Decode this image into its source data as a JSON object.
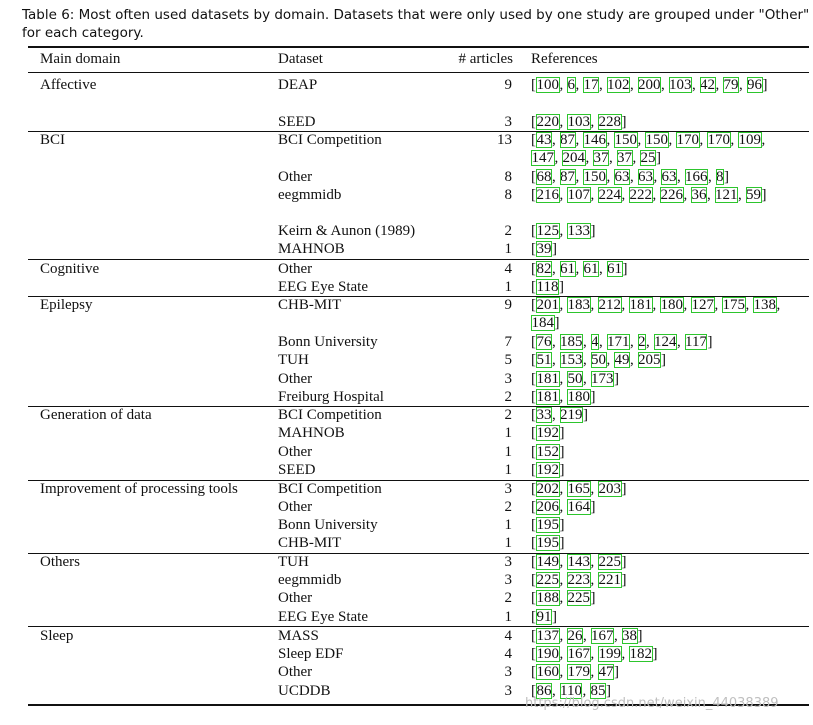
{
  "caption": "Table 6: Most often used datasets by domain. Datasets that were only used by one study are grouped under \"Other\" for each category.",
  "headers": [
    "Main domain",
    "Dataset",
    "# articles",
    "References"
  ],
  "groups": [
    {
      "domain": "Affective",
      "rows": [
        {
          "dataset": "DEAP",
          "articles": "9",
          "refs": [
            "100",
            "6",
            "17",
            "102",
            "200",
            "103",
            "42",
            "79",
            "96"
          ]
        },
        {
          "dataset": "SEED",
          "articles": "3",
          "refs": [
            "220",
            "103",
            "228"
          ]
        }
      ]
    },
    {
      "domain": "BCI",
      "rows": [
        {
          "dataset": "BCI Competition",
          "articles": "13",
          "refs": [
            "43",
            "87",
            "146",
            "150",
            "150",
            "170",
            "170",
            "109",
            "147",
            "204",
            "37",
            "37",
            "25"
          ]
        },
        {
          "dataset": "Other",
          "articles": "8",
          "refs": [
            "68",
            "87",
            "150",
            "63",
            "63",
            "63",
            "166",
            "8"
          ]
        },
        {
          "dataset": "eegmmidb",
          "articles": "8",
          "refs": [
            "216",
            "107",
            "224",
            "222",
            "226",
            "36",
            "121",
            "59"
          ]
        },
        {
          "dataset": "Keirn & Aunon (1989)",
          "articles": "2",
          "refs": [
            "125",
            "133"
          ]
        },
        {
          "dataset": "MAHNOB",
          "articles": "1",
          "refs": [
            "39"
          ]
        }
      ]
    },
    {
      "domain": "Cognitive",
      "rows": [
        {
          "dataset": "Other",
          "articles": "4",
          "refs": [
            "82",
            "61",
            "61",
            "61"
          ]
        },
        {
          "dataset": "EEG Eye State",
          "articles": "1",
          "refs": [
            "118"
          ]
        }
      ]
    },
    {
      "domain": "Epilepsy",
      "rows": [
        {
          "dataset": "CHB-MIT",
          "articles": "9",
          "refs": [
            "201",
            "183",
            "212",
            "181",
            "180",
            "127",
            "175",
            "138",
            "184"
          ]
        },
        {
          "dataset": "Bonn University",
          "articles": "7",
          "refs": [
            "76",
            "185",
            "4",
            "171",
            "2",
            "124",
            "117"
          ]
        },
        {
          "dataset": "TUH",
          "articles": "5",
          "refs": [
            "51",
            "153",
            "50",
            "49",
            "205"
          ]
        },
        {
          "dataset": "Other",
          "articles": "3",
          "refs": [
            "181",
            "50",
            "173"
          ]
        },
        {
          "dataset": "Freiburg Hospital",
          "articles": "2",
          "refs": [
            "181",
            "180"
          ]
        }
      ]
    },
    {
      "domain": "Generation of data",
      "rows": [
        {
          "dataset": "BCI Competition",
          "articles": "2",
          "refs": [
            "33",
            "219"
          ]
        },
        {
          "dataset": "MAHNOB",
          "articles": "1",
          "refs": [
            "192"
          ]
        },
        {
          "dataset": "Other",
          "articles": "1",
          "refs": [
            "152"
          ]
        },
        {
          "dataset": "SEED",
          "articles": "1",
          "refs": [
            "192"
          ]
        }
      ]
    },
    {
      "domain": "Improvement of processing tools",
      "rows": [
        {
          "dataset": "BCI Competition",
          "articles": "3",
          "refs": [
            "202",
            "165",
            "203"
          ]
        },
        {
          "dataset": "Other",
          "articles": "2",
          "refs": [
            "206",
            "164"
          ]
        },
        {
          "dataset": "Bonn University",
          "articles": "1",
          "refs": [
            "195"
          ]
        },
        {
          "dataset": "CHB-MIT",
          "articles": "1",
          "refs": [
            "195"
          ]
        }
      ]
    },
    {
      "domain": "Others",
      "rows": [
        {
          "dataset": "TUH",
          "articles": "3",
          "refs": [
            "149",
            "143",
            "225"
          ]
        },
        {
          "dataset": "eegmmidb",
          "articles": "3",
          "refs": [
            "225",
            "223",
            "221"
          ]
        },
        {
          "dataset": "Other",
          "articles": "2",
          "refs": [
            "188",
            "225"
          ]
        },
        {
          "dataset": "EEG Eye State",
          "articles": "1",
          "refs": [
            "91"
          ]
        }
      ]
    },
    {
      "domain": "Sleep",
      "rows": [
        {
          "dataset": "MASS",
          "articles": "4",
          "refs": [
            "137",
            "26",
            "167",
            "38"
          ]
        },
        {
          "dataset": "Sleep EDF",
          "articles": "4",
          "refs": [
            "190",
            "167",
            "199",
            "182"
          ]
        },
        {
          "dataset": "Other",
          "articles": "3",
          "refs": [
            "160",
            "179",
            "47"
          ]
        },
        {
          "dataset": "UCDDB",
          "articles": "3",
          "refs": [
            "86",
            "110",
            "85"
          ]
        }
      ]
    }
  ],
  "watermark": "https://blog.csdn.net/weixin_44038389"
}
